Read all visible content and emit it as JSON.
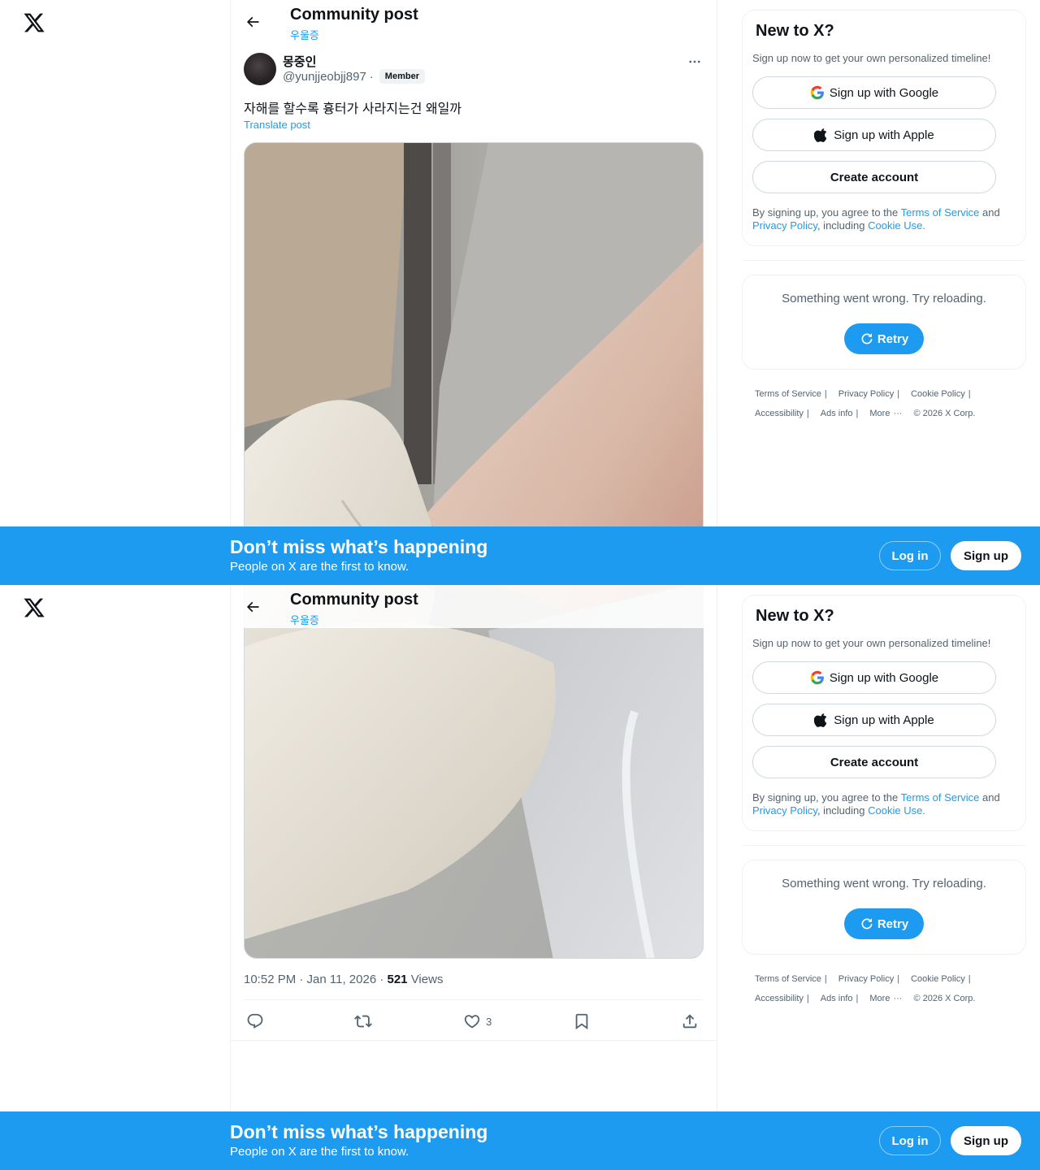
{
  "nav": {
    "logo_icon": "x-logo-icon"
  },
  "header": {
    "title": "Community post",
    "community": "우울증"
  },
  "post": {
    "display_name": "몽중인",
    "handle": "@yunjjeobjj897",
    "separator": "·",
    "badge": "Member",
    "text": "자해를 할수록 흉터가 사라지는건 왜일까",
    "translate_label": "Translate post",
    "time": "10:52 PM · Jan 11, 2026 · ",
    "views_count": "521",
    "views_label": " Views",
    "like_count": "3"
  },
  "sidebar": {
    "title": "New to X?",
    "desc": "Sign up now to get your own personalized timeline!",
    "google_label": "Sign up with Google",
    "apple_label": "Sign up with Apple",
    "create_label": "Create account",
    "terms_prefix": "By signing up, you agree to the ",
    "terms_link": "Terms of Service",
    "terms_and": " and ",
    "privacy_link": "Privacy Policy",
    "including": ", including ",
    "cookie_link": "Cookie Use.",
    "error_text": "Something went wrong. Try reloading.",
    "retry_label": "Retry"
  },
  "footer": {
    "terms": "Terms of Service",
    "privacy": "Privacy Policy",
    "cookie": "Cookie Policy",
    "accessibility": "Accessibility",
    "ads": "Ads info",
    "more": "More",
    "copyright": "© 2026 X Corp.",
    "sep": "|"
  },
  "banner": {
    "title": "Don’t miss what’s happening",
    "subtitle": "People on X are the first to know.",
    "login": "Log in",
    "signup": "Sign up"
  },
  "colors": {
    "accent": "#1d9bf0",
    "text": "#0f1419",
    "muted": "#536471",
    "border": "#eff3f4"
  }
}
